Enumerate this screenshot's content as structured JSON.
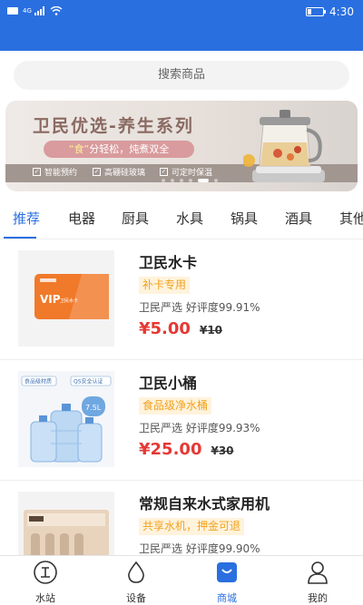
{
  "status_bar": {
    "signal_text": "4G",
    "time": "4:30"
  },
  "search": {
    "placeholder": "搜索商品"
  },
  "banner": {
    "title": "卫民优选-养生系列",
    "subtitle_highlight": "“食”",
    "subtitle_rest": "分轻松，炖煮双全",
    "features": [
      "智能预约",
      "高硼硅玻璃",
      "可定时保温"
    ],
    "slide_count": 6,
    "active_slide": 4
  },
  "tabs": [
    "推荐",
    "电器",
    "厨具",
    "水具",
    "锅具",
    "酒具",
    "其他"
  ],
  "active_tab": 0,
  "products": [
    {
      "name": "卫民水卡",
      "tag": "补卡专用",
      "rating": "卫民严选 好评度99.91%",
      "price": "5.00",
      "old_price": "10",
      "card_text": "VIP",
      "card_small": "卫民水卡"
    },
    {
      "name": "卫民小桶",
      "tag": "食品级净水桶",
      "rating": "卫民严选 好评度99.93%",
      "price": "25.00",
      "old_price": "30",
      "badge_left": "食品级材质",
      "badge_right": "QS安全认证",
      "volume": "7.5L"
    },
    {
      "name": "常规自来水式家用机",
      "tag": "共享水机，押金可退",
      "rating": "卫民严选 好评度99.90%",
      "price": "",
      "old_price": ""
    }
  ],
  "currency": "¥",
  "navbar": {
    "items": [
      {
        "label": "水站",
        "icon": "water-station-icon"
      },
      {
        "label": "设备",
        "icon": "water-drop-icon"
      },
      {
        "label": "商城",
        "icon": "shopping-bag-icon"
      },
      {
        "label": "我的",
        "icon": "user-icon"
      }
    ],
    "active": 2
  },
  "colors": {
    "primary": "#2a6fdf",
    "price": "#e53935",
    "tag": "#f0a21f"
  }
}
